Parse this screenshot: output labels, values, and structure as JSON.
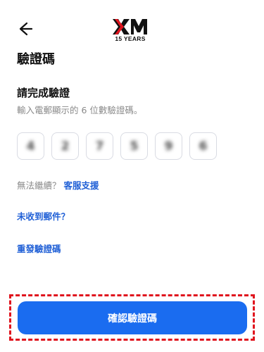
{
  "header": {
    "back_icon": "arrow-left-icon",
    "logo_text": "XM",
    "logo_subtitle": "15 YEARS",
    "brand_color": "#e0141e"
  },
  "page_title": "驗證碼",
  "verification": {
    "title": "請完成驗證",
    "hint": "輸入電郵顯示的 6 位數驗證碼。",
    "digits": [
      "4",
      "2",
      "7",
      "5",
      "9",
      "6"
    ]
  },
  "help": {
    "text": "無法繼續？",
    "link": "客服支援"
  },
  "links": {
    "no_email": "未收到郵件？",
    "resend": "重發驗證碼"
  },
  "confirm_button": {
    "label": "確認驗證碼",
    "color": "#1a6cf0"
  },
  "accent_color": "#1f5fd6",
  "highlight_color": "#e0141e"
}
